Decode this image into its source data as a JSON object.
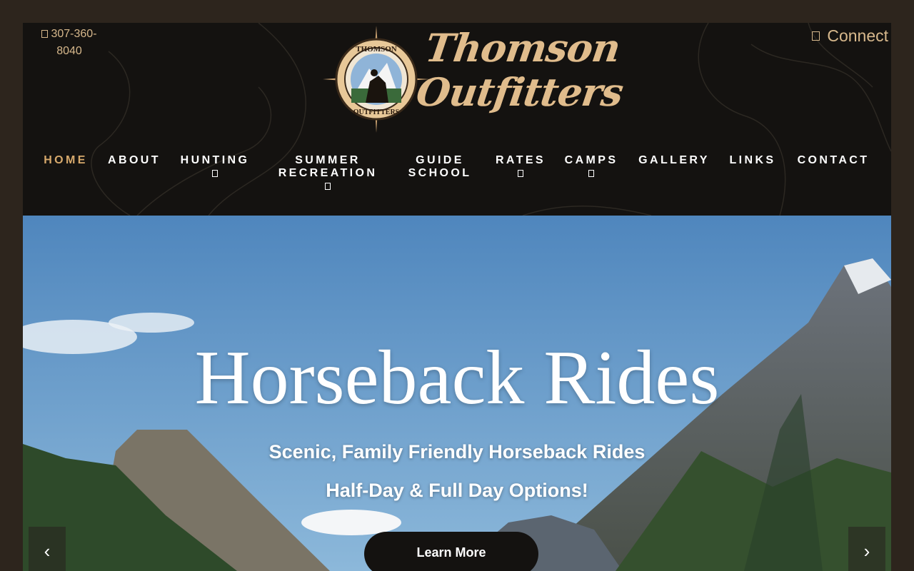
{
  "header": {
    "phone": "307-360-8040",
    "phone_icon": "phone-icon",
    "connect_label": "Connect",
    "connect_icon": "user-icon",
    "logo_line1": "Thomson",
    "logo_line2": "Outfitters",
    "badge_top": "THOMSON",
    "badge_bottom": "OUTFITTERS"
  },
  "nav": {
    "items": [
      {
        "label": "HOME",
        "active": true
      },
      {
        "label": "ABOUT"
      },
      {
        "label": "HUNTING",
        "dropdown": true
      },
      {
        "label": "SUMMER RECREATION",
        "dropdown": true
      },
      {
        "label": "GUIDE SCHOOL"
      },
      {
        "label": "RATES",
        "dropdown": true
      },
      {
        "label": "CAMPS",
        "dropdown": true
      },
      {
        "label": "GALLERY"
      },
      {
        "label": "LINKS"
      },
      {
        "label": "CONTACT"
      }
    ]
  },
  "hero": {
    "title": "Horseback Rides",
    "subtitle1": "Scenic, Family Friendly Horseback Rides",
    "subtitle2": "Half-Day & Full Day Options!",
    "cta_label": "Learn More",
    "prev_icon": "chevron-left-icon",
    "next_icon": "chevron-right-icon"
  },
  "colors": {
    "accent": "#d7b88c",
    "header_bg": "#141210",
    "page_bg": "#2d251d"
  }
}
